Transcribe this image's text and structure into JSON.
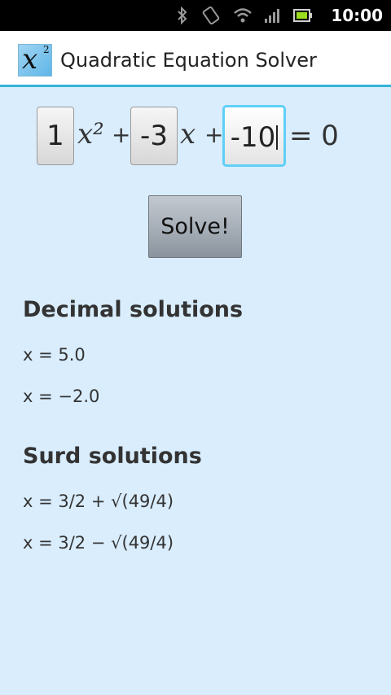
{
  "status_bar": {
    "time": "10:00",
    "icons": [
      "bluetooth-icon",
      "rotate-icon",
      "wifi-icon",
      "signal-icon",
      "battery-icon"
    ]
  },
  "app": {
    "title": "Quadratic Equation Solver",
    "icon": "x-squared-icon",
    "icon_text": "x",
    "icon_sup": "2"
  },
  "equation": {
    "a": "1",
    "b": "-3",
    "c": "-10",
    "x_squared": "x²",
    "x": "x",
    "plus": "+",
    "equals": "= 0"
  },
  "solve_label": "Solve!",
  "decimal": {
    "heading": "Decimal solutions",
    "solutions": [
      "x = 5.0",
      "x = −2.0"
    ]
  },
  "surd": {
    "heading": "Surd solutions",
    "solutions": [
      "x = 3/2 + √(49/4)",
      "x = 3/2 − √(49/4)"
    ]
  },
  "colors": {
    "background": "#d9edfd",
    "accent": "#35b4d8",
    "focus": "#5fd0f7"
  }
}
